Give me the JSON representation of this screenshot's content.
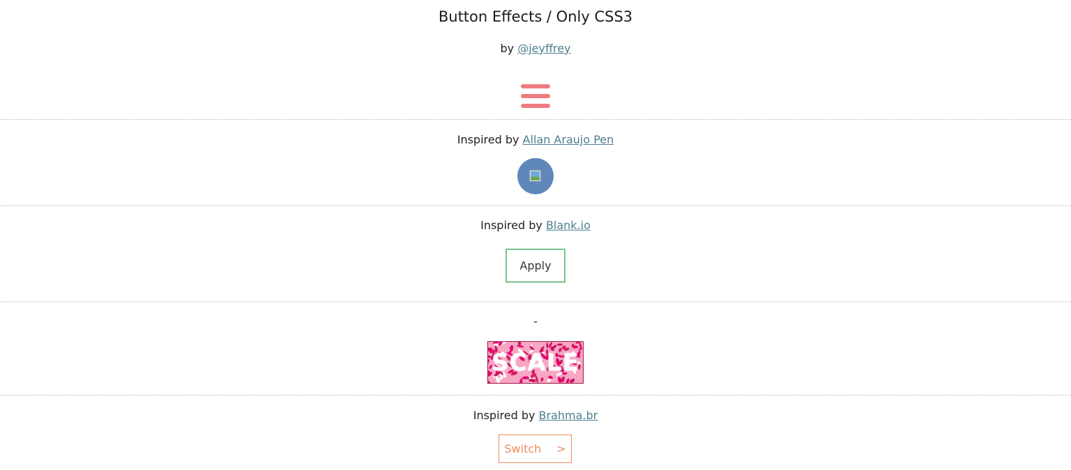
{
  "header": {
    "title": "Button Effects / Only CSS3",
    "by_prefix": "by ",
    "author_link": "@jeyffrey"
  },
  "menu": {
    "icon": "hamburger-menu-icon",
    "color": "#ee7b7f"
  },
  "sections": [
    {
      "caption_prefix": "Inspired by ",
      "caption_link": "Allan Araujo Pen",
      "button_icon": "broken-image-icon",
      "button_color": "#5f87ba"
    },
    {
      "caption_prefix": "Inspired by ",
      "caption_link": "Blank.io",
      "button_label": "Apply",
      "button_border_color": "#7cc48f"
    },
    {
      "caption": "-",
      "button_label": "SCALE",
      "pattern_colors": [
        "#e6006e",
        "#f7a6c4",
        "#c2185b",
        "#ffffff",
        "#d81b60"
      ]
    },
    {
      "caption_prefix": "Inspired by ",
      "caption_link": "Brahma.br",
      "button_label": "Switch",
      "button_arrow": ">",
      "button_color": "#f08a5d"
    }
  ]
}
